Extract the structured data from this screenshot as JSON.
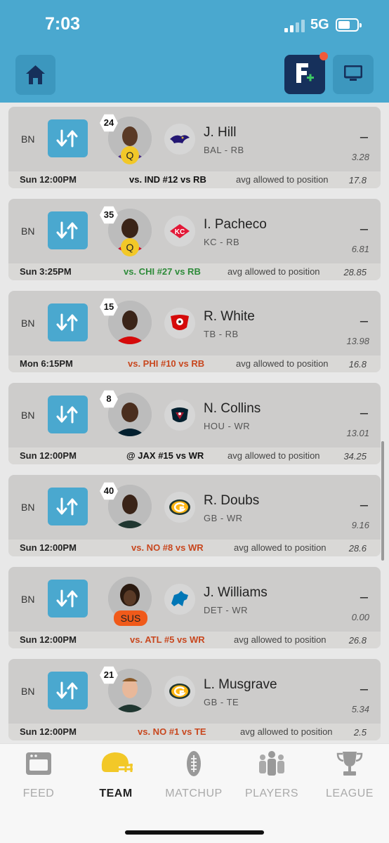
{
  "status": {
    "time": "7:03",
    "network": "5G"
  },
  "header": {
    "home_icon": "home-icon",
    "fantasy_icon": "fantasy-plus-icon",
    "tv_icon": "tv-icon",
    "accent": "#4aa8cf"
  },
  "players": [
    {
      "slot": "BN",
      "number": "24",
      "name": "J. Hill",
      "team_pos": "BAL - RB",
      "score": "–",
      "projection": "3.28",
      "status": "Q",
      "kickoff": "Sun 12:00PM",
      "matchup": "vs. IND #12 vs RB",
      "matchup_color": "#111111",
      "allowed_label": "avg allowed to position",
      "allowed_value": "17.8",
      "team_logo": "ravens-logo"
    },
    {
      "slot": "BN",
      "number": "35",
      "name": "I. Pacheco",
      "team_pos": "KC - RB",
      "score": "–",
      "projection": "6.81",
      "status": "Q",
      "kickoff": "Sun 3:25PM",
      "matchup": "vs. CHI #27 vs RB",
      "matchup_color": "#2e8b3a",
      "allowed_label": "avg allowed to position",
      "allowed_value": "28.85",
      "team_logo": "chiefs-logo"
    },
    {
      "slot": "BN",
      "number": "15",
      "name": "R. White",
      "team_pos": "TB - RB",
      "score": "–",
      "projection": "13.98",
      "status": "",
      "kickoff": "Mon 6:15PM",
      "matchup": "vs. PHI #10 vs RB",
      "matchup_color": "#c8471e",
      "allowed_label": "avg allowed to position",
      "allowed_value": "16.8",
      "team_logo": "buccaneers-logo"
    },
    {
      "slot": "BN",
      "number": "8",
      "name": "N. Collins",
      "team_pos": "HOU - WR",
      "score": "–",
      "projection": "13.01",
      "status": "",
      "kickoff": "Sun 12:00PM",
      "matchup": "@ JAX #15 vs WR",
      "matchup_color": "#111111",
      "allowed_label": "avg allowed to position",
      "allowed_value": "34.25",
      "team_logo": "texans-logo"
    },
    {
      "slot": "BN",
      "number": "40",
      "name": "R. Doubs",
      "team_pos": "GB - WR",
      "score": "–",
      "projection": "9.16",
      "status": "",
      "kickoff": "Sun 12:00PM",
      "matchup": "vs. NO #8 vs WR",
      "matchup_color": "#c8471e",
      "allowed_label": "avg allowed to position",
      "allowed_value": "28.6",
      "team_logo": "packers-logo"
    },
    {
      "slot": "BN",
      "number": "",
      "name": "J. Williams",
      "team_pos": "DET - WR",
      "score": "–",
      "projection": "0.00",
      "status": "SUS",
      "kickoff": "Sun 12:00PM",
      "matchup": "vs. ATL #5 vs WR",
      "matchup_color": "#c8471e",
      "allowed_label": "avg allowed to position",
      "allowed_value": "26.8",
      "team_logo": "lions-logo"
    },
    {
      "slot": "BN",
      "number": "21",
      "name": "L. Musgrave",
      "team_pos": "GB - TE",
      "score": "–",
      "projection": "5.34",
      "status": "",
      "kickoff": "Sun 12:00PM",
      "matchup": "vs. NO #1 vs TE",
      "matchup_color": "#c8471e",
      "allowed_label": "avg allowed to position",
      "allowed_value": "2.5",
      "team_logo": "packers-logo"
    }
  ],
  "tabs": [
    {
      "label": "FEED",
      "icon": "feed-icon",
      "active": false
    },
    {
      "label": "TEAM",
      "icon": "helmet-icon",
      "active": true
    },
    {
      "label": "MATCHUP",
      "icon": "football-icon",
      "active": false
    },
    {
      "label": "PLAYERS",
      "icon": "players-icon",
      "active": false
    },
    {
      "label": "LEAGUE",
      "icon": "trophy-icon",
      "active": false
    }
  ]
}
